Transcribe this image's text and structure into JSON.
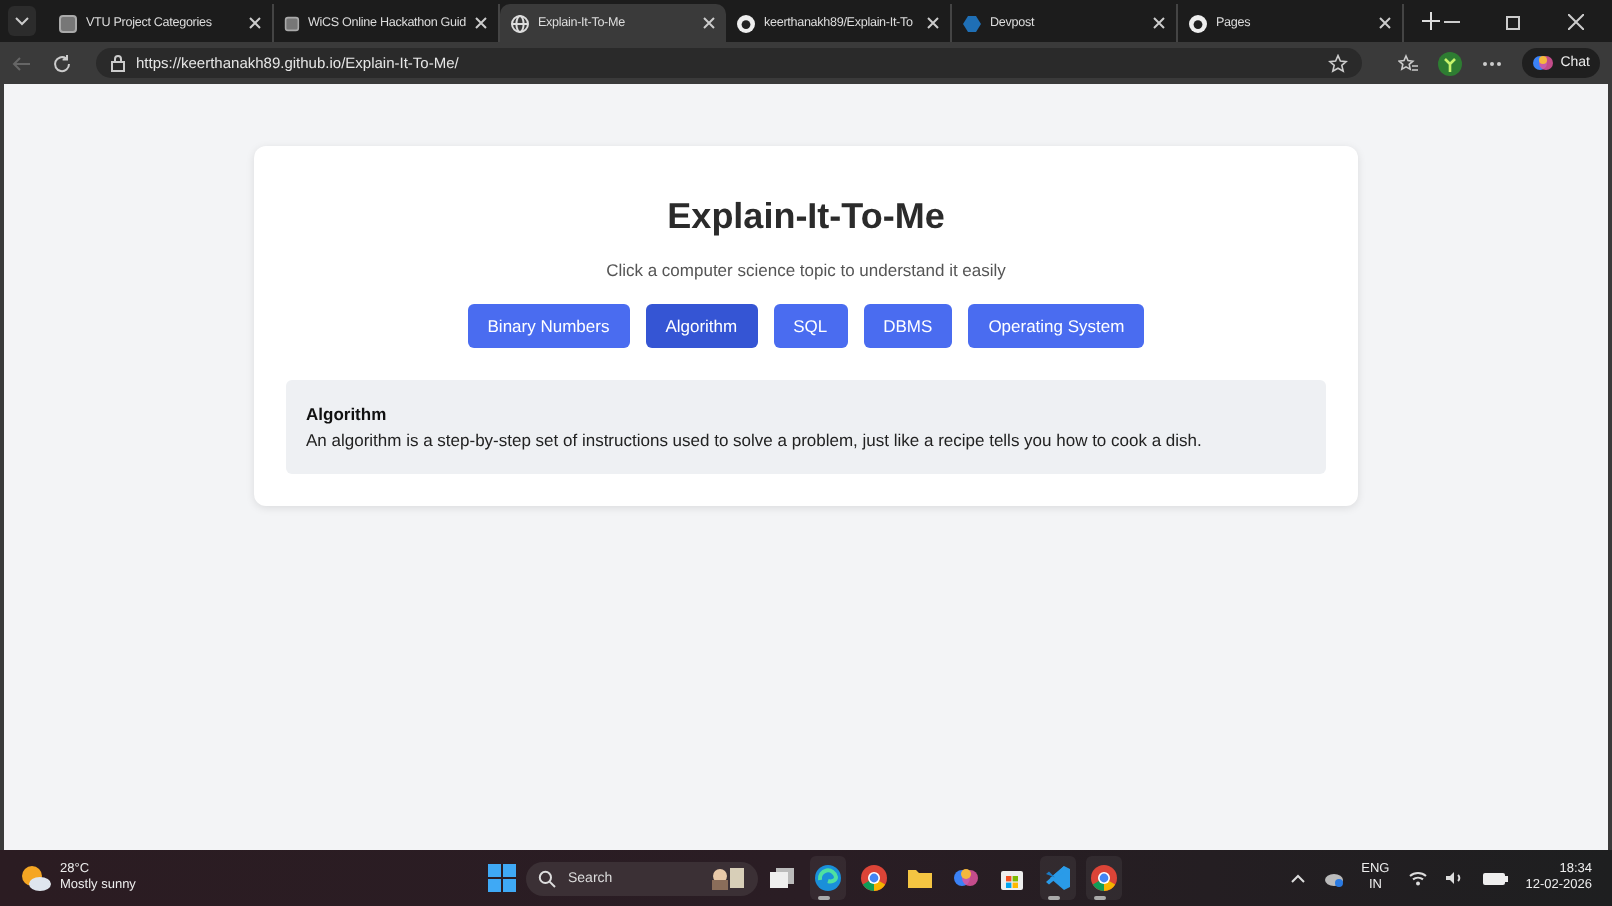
{
  "browser": {
    "tabs": [
      {
        "title": "VTU Project Categories",
        "kind": "page",
        "selected": false
      },
      {
        "title": "WiCS Online Hackathon Guid",
        "kind": "page",
        "selected": false
      },
      {
        "title": "Explain-It-To-Me",
        "kind": "globe",
        "selected": true
      },
      {
        "title": "keerthanakh89/Explain-It-To",
        "kind": "github",
        "selected": false
      },
      {
        "title": "Devpost",
        "kind": "devpost",
        "selected": false
      },
      {
        "title": "Pages",
        "kind": "github",
        "selected": false
      }
    ],
    "url": "https://keerthanakh89.github.io/Explain-It-To-Me/",
    "chat_label": "Chat"
  },
  "page": {
    "title": "Explain-It-To-Me",
    "subtitle": "Click a computer science topic to understand it easily",
    "topics": [
      {
        "label": "Binary Numbers",
        "selected": false
      },
      {
        "label": "Algorithm",
        "selected": true
      },
      {
        "label": "SQL",
        "selected": false
      },
      {
        "label": "DBMS",
        "selected": false
      },
      {
        "label": "Operating System",
        "selected": false
      }
    ],
    "explanation": {
      "heading": "Algorithm",
      "text": "An algorithm is a step-by-step set of instructions used to solve a problem, just like a recipe tells you how to cook a dish."
    }
  },
  "taskbar": {
    "weather": {
      "temperature": "28°C",
      "condition": "Mostly sunny"
    },
    "search_placeholder": "Search",
    "apps": [
      {
        "kind": "taskview",
        "running": false
      },
      {
        "kind": "edge",
        "running": true
      },
      {
        "kind": "chrome",
        "running": false
      },
      {
        "kind": "files",
        "running": false
      },
      {
        "kind": "copilot",
        "running": false
      },
      {
        "kind": "store",
        "running": false
      },
      {
        "kind": "vscode",
        "running": true
      },
      {
        "kind": "chrome",
        "running": true
      }
    ],
    "language": "ENG",
    "region": "IN",
    "time": "18:34",
    "date": "12-02-2026"
  }
}
